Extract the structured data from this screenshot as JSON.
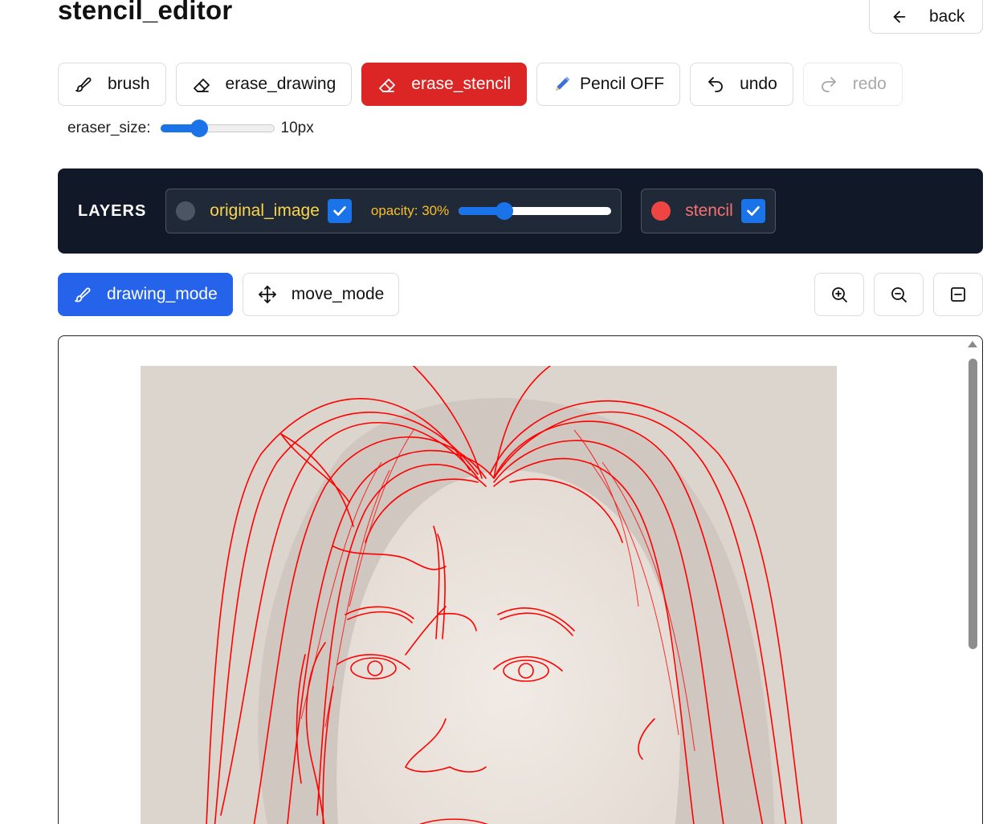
{
  "page": {
    "title": "stencil_editor"
  },
  "header": {
    "back_label": "back"
  },
  "toolbar": {
    "brush": "brush",
    "erase_drawing": "erase_drawing",
    "erase_stencil": "erase_stencil",
    "pencil": "Pencil OFF",
    "undo": "undo",
    "redo": "redo",
    "active_tool": "erase_stencil"
  },
  "eraser": {
    "label": "eraser_size:",
    "value_text": "10px",
    "slider_level": 0.34
  },
  "layers": {
    "title": "LAYERS",
    "original": {
      "name": "original_image",
      "visible": true,
      "opacity_label": "opacity: 30%",
      "opacity": 0.3,
      "name_color": "#fbd54a"
    },
    "stencil": {
      "name": "stencil",
      "visible": true,
      "name_color": "#f87171",
      "dot_color": "#ef4444"
    }
  },
  "modes": {
    "drawing": "drawing_mode",
    "move": "move_mode",
    "active": "drawing_mode"
  },
  "zoom": {
    "in_icon": "zoom-in-icon",
    "out_icon": "zoom-out-icon",
    "fit_icon": "minus-square-icon"
  },
  "colors": {
    "accent_red": "#dc2626",
    "accent_blue": "#2563eb",
    "layers_bg": "#111827",
    "stencil_stroke": "#ff0000"
  }
}
